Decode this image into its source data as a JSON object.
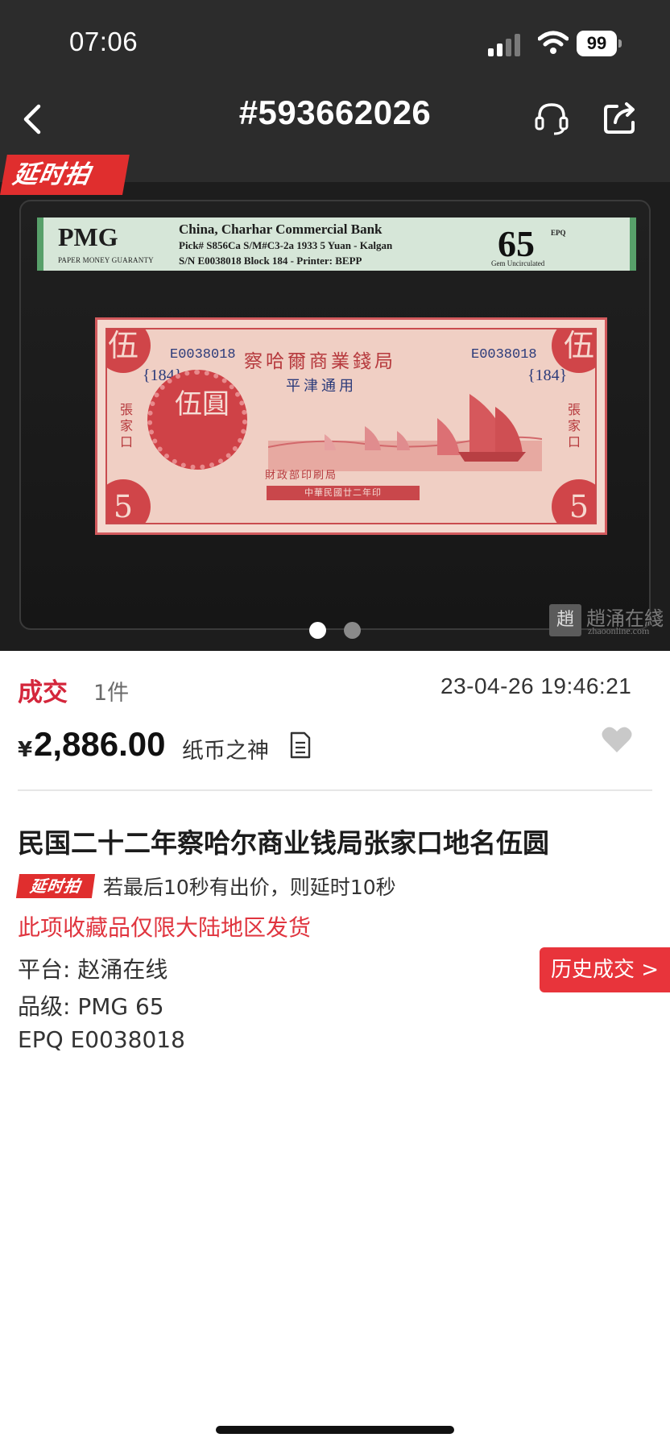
{
  "status_bar": {
    "time": "07:06",
    "battery": "99"
  },
  "header": {
    "title": "#593662026"
  },
  "carousel": {
    "badge": "延时拍",
    "page_count": 2,
    "active_index": 0,
    "slab_label": {
      "logo": "PMG",
      "logo_sub": "PAPER MONEY GUARANTY",
      "line1": "China, Charhar Commercial Bank",
      "line2": "Pick# S856Ca  S/M#C3-2a     1933  5 Yuan - Kalgan",
      "line3": "S/N E0038018 Block 184 - Printer: BEPP",
      "grade": "65",
      "grade_suffix": "EPQ",
      "grade_desc": "Gem Uncirculated"
    },
    "note": {
      "serial": "E0038018",
      "block": "{184}",
      "bank_name": "察哈爾商業錢局",
      "sub_text": "平津通用",
      "denomination": "伍圓",
      "corner_char": "伍",
      "corner_num": "5",
      "place": "張家口",
      "printer": "財政部印刷局",
      "date": "中華民國廿二年印"
    },
    "watermark": {
      "seal": "趙",
      "text": "趙涌在綫",
      "url": "zhaoonline.com"
    }
  },
  "deal": {
    "status": "成交",
    "quantity": "1件",
    "time": "23-04-26 19:46:21",
    "currency": "¥",
    "price": "2,886.00",
    "seller": "纸币之神"
  },
  "item": {
    "title": "民国二十二年察哈尔商业钱局张家口地名伍圆",
    "badge": "延时拍",
    "extend_note": "若最后10秒有出价，则延时10秒",
    "region_note": "此项收藏品仅限大陆地区发货",
    "platform": "平台: 赵涌在线",
    "grade": "品级: PMG 65",
    "epq": "EPQ  E0038018",
    "history_button": "历史成交 >"
  },
  "colors": {
    "header_bg": "#2c2c2c",
    "accent_red": "#e02e2e",
    "status_red": "#d4263b",
    "note_red": "#cf4247"
  }
}
